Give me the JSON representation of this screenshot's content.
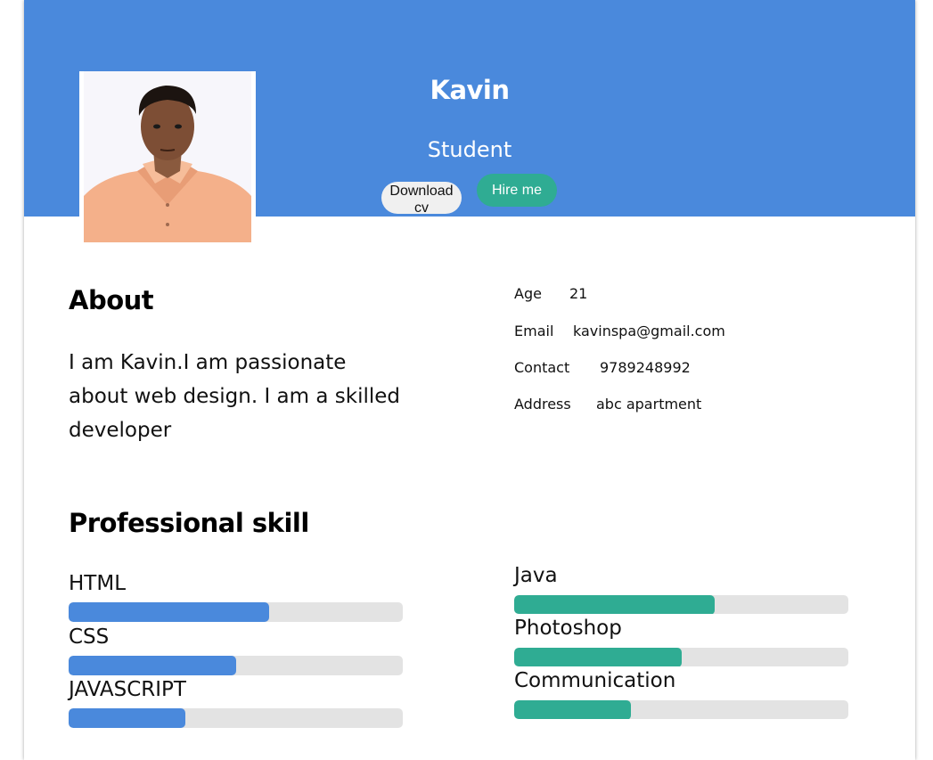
{
  "profile": {
    "name": "Kavin",
    "title": "Student",
    "download_label": "Download cv",
    "hire_label": "Hire me"
  },
  "about": {
    "heading": "About",
    "text": "I am Kavin.I am passionate about web design. I am a skilled developer"
  },
  "info": [
    {
      "label": "Age",
      "value": "21"
    },
    {
      "label": "Email",
      "value": "kavinspa@gmail.com"
    },
    {
      "label": "Contact",
      "value": "9789248992"
    },
    {
      "label": "Address",
      "value": "abc apartment"
    }
  ],
  "skills": {
    "heading": "Professional skill",
    "left": [
      {
        "name": "HTML",
        "level": 0.6
      },
      {
        "name": "CSS",
        "level": 0.5
      },
      {
        "name": "JAVASCRIPT",
        "level": 0.35
      }
    ],
    "right": [
      {
        "name": "Java",
        "level": 0.6
      },
      {
        "name": "Photoshop",
        "level": 0.5
      },
      {
        "name": "Communication",
        "level": 0.35
      }
    ]
  },
  "colors": {
    "header": "#4a89dc",
    "accent_teal": "#2fac93",
    "bar_blue": "#4a89dc",
    "bar_track": "#e3e3e3"
  }
}
